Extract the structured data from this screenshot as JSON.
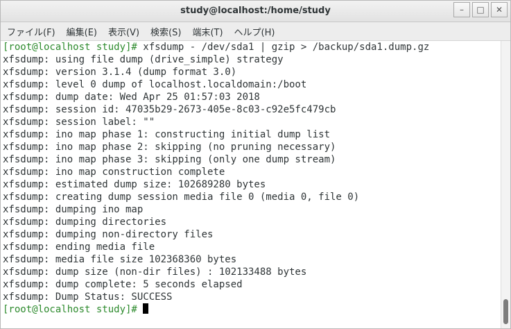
{
  "window": {
    "title": "study@localhost:/home/study",
    "buttons": [
      "–",
      "□",
      "✕"
    ]
  },
  "menu": {
    "items": [
      "ファイル(F)",
      "編集(E)",
      "表示(V)",
      "検索(S)",
      "端末(T)",
      "ヘルプ(H)"
    ]
  },
  "terminal": {
    "prompt": "[root@localhost study]#",
    "command": " xfsdump - /dev/sda1 | gzip > /backup/sda1.dump.gz",
    "output": [
      "xfsdump: using file dump (drive_simple) strategy",
      "xfsdump: version 3.1.4 (dump format 3.0)",
      "xfsdump: level 0 dump of localhost.localdomain:/boot",
      "xfsdump: dump date: Wed Apr 25 01:57:03 2018",
      "xfsdump: session id: 47035b29-2673-405e-8c03-c92e5fc479cb",
      "xfsdump: session label: \"\"",
      "xfsdump: ino map phase 1: constructing initial dump list",
      "xfsdump: ino map phase 2: skipping (no pruning necessary)",
      "xfsdump: ino map phase 3: skipping (only one dump stream)",
      "xfsdump: ino map construction complete",
      "xfsdump: estimated dump size: 102689280 bytes",
      "xfsdump: creating dump session media file 0 (media 0, file 0)",
      "xfsdump: dumping ino map",
      "xfsdump: dumping directories",
      "xfsdump: dumping non-directory files",
      "xfsdump: ending media file",
      "xfsdump: media file size 102368360 bytes",
      "xfsdump: dump size (non-dir files) : 102133488 bytes",
      "xfsdump: dump complete: 5 seconds elapsed",
      "xfsdump: Dump Status: SUCCESS"
    ],
    "final_prompt": "[root@localhost study]#"
  },
  "colors": {
    "prompt": "#2e8b2e",
    "text": "#2e3436",
    "background": "#ffffff"
  }
}
